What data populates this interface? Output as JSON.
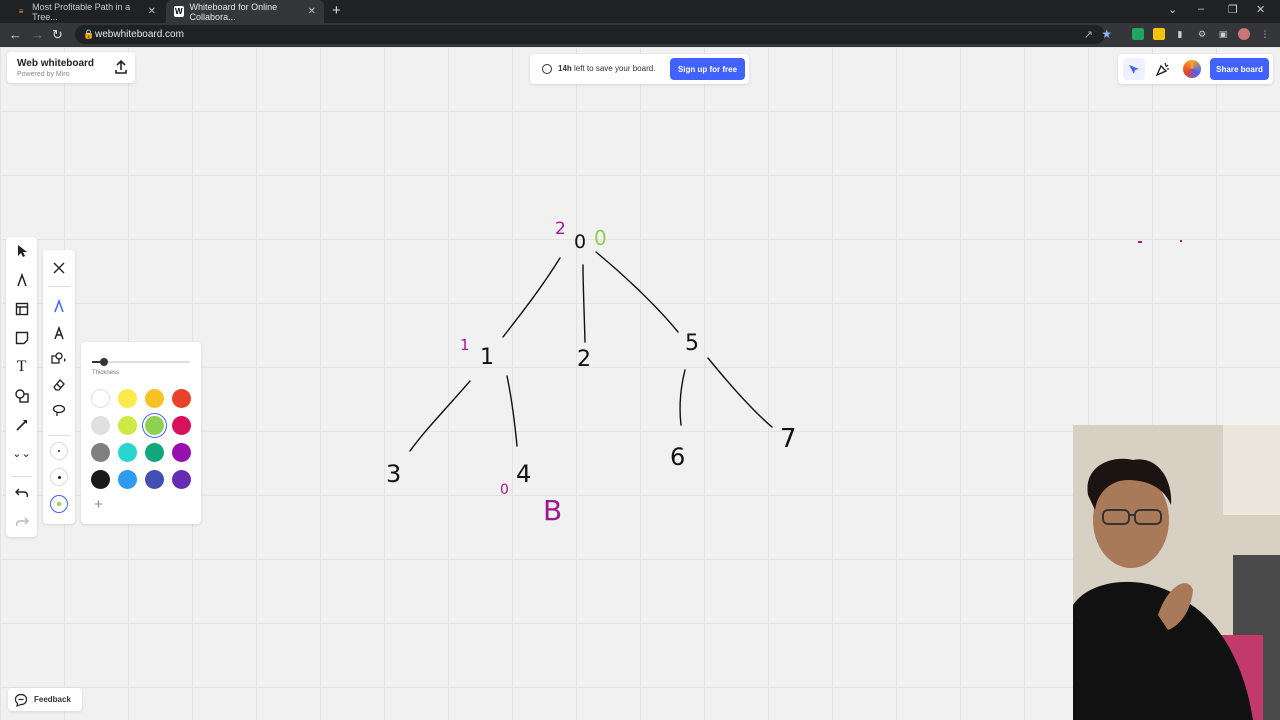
{
  "browser": {
    "tabs": [
      {
        "title": "Most Profitable Path in a Tree...",
        "active": false,
        "favicon": "code-icon"
      },
      {
        "title": "Whiteboard for Online Collabora...",
        "active": true,
        "favicon": "w-icon"
      }
    ],
    "url": "webwhiteboard.com"
  },
  "header": {
    "app_title": "Web whiteboard",
    "app_subtitle": "Powered by Miro"
  },
  "save_banner": {
    "time": "14h",
    "message": "left to save your board.",
    "signup_label": "Sign up for free"
  },
  "share": {
    "share_label": "Share board"
  },
  "pen_panel": {
    "thickness_label": "Thickness",
    "thickness_value": 0.12,
    "colors": [
      "#ffffff",
      "#fce94a",
      "#f5c325",
      "#e8422a",
      "#e0e0e0",
      "#cee844",
      "#8fd14f",
      "#d8115d",
      "#808080",
      "#2ad4cf",
      "#13a57c",
      "#9510ac",
      "#1a1a1a",
      "#2d9bf0",
      "#4350b3",
      "#652cb3"
    ],
    "selected_color": "#8fd14f"
  },
  "feedback": {
    "label": "Feedback"
  },
  "tree": {
    "root": "0",
    "children_of_root": [
      "1",
      "2",
      "5"
    ],
    "children_of_1": [
      "3",
      "4"
    ],
    "children_of_5": [
      "6",
      "7"
    ],
    "annotations": {
      "purple_2": "2",
      "green_0": "0",
      "purple_1": "1",
      "purple_0": "0",
      "purple_B": "B"
    }
  }
}
